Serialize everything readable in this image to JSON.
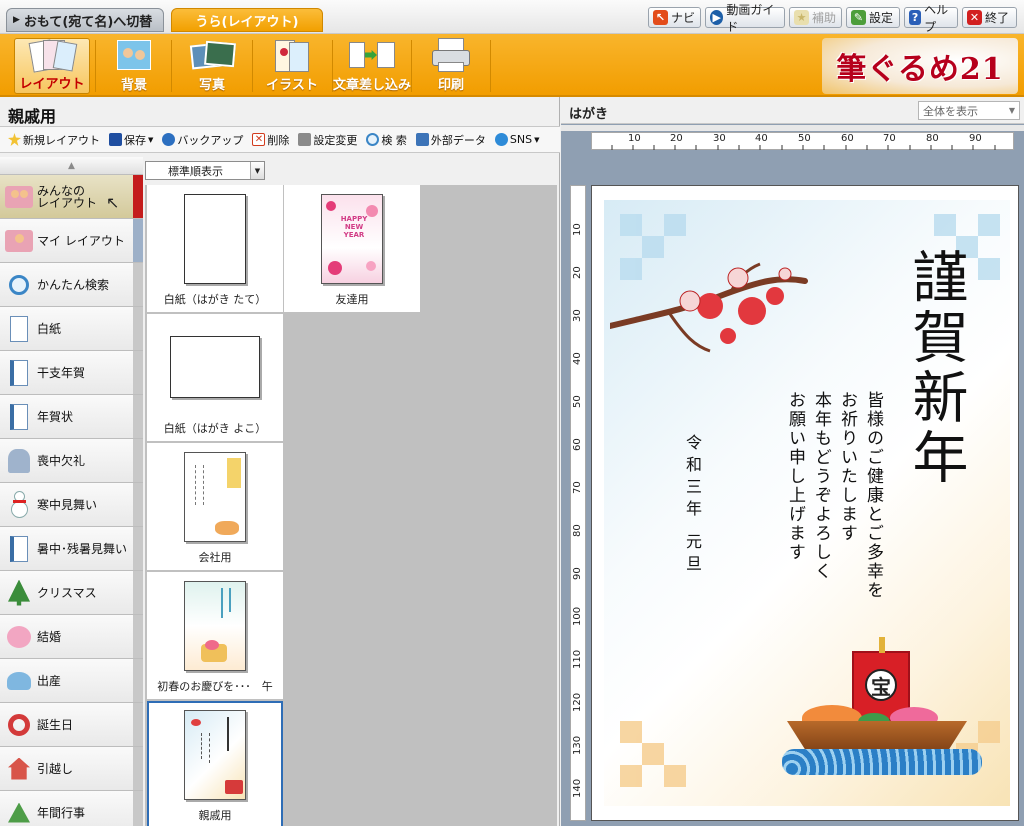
{
  "top_tabs": {
    "front": "おもて(宛て名)へ切替",
    "back": "うら(レイアウト)"
  },
  "utility_buttons": [
    {
      "label": "ナビ",
      "icon": "navi-arrow-icon"
    },
    {
      "label": "動画ガイド",
      "icon": "video-play-icon"
    },
    {
      "label": "補助",
      "icon": "assist-star-icon",
      "disabled": true
    },
    {
      "label": "設定",
      "icon": "settings-wrench-icon"
    },
    {
      "label": "ヘルプ",
      "icon": "help-question-icon"
    },
    {
      "label": "終了",
      "icon": "close-x-icon"
    }
  ],
  "toolbar": {
    "items": [
      {
        "label": "レイアウト",
        "icon": "layout-cards-icon",
        "active": true
      },
      {
        "label": "背景",
        "icon": "background-people-icon"
      },
      {
        "label": "写真",
        "icon": "photo-icon"
      },
      {
        "label": "イラスト",
        "icon": "illustration-icon"
      },
      {
        "label": "文章差し込み",
        "icon": "text-insert-icon"
      },
      {
        "label": "印刷",
        "icon": "printer-icon"
      }
    ],
    "logo": "筆ぐるめ21"
  },
  "left_panel": {
    "title": "親戚用",
    "actions": [
      {
        "label": "新規レイアウト",
        "icon": "new-layout-icon",
        "color": "#e0a000"
      },
      {
        "label": "保存",
        "icon": "save-floppy-icon",
        "color": "#1f4ea0",
        "dropdown": true
      },
      {
        "label": "バックアップ",
        "icon": "backup-icon",
        "color": "#2c6fc0"
      },
      {
        "label": "削除",
        "icon": "delete-icon",
        "color": "#d23c1e"
      },
      {
        "label": "設定変更",
        "icon": "settings-change-icon",
        "color": "#555555"
      },
      {
        "label": "検 索",
        "icon": "search-icon",
        "color": "#3b86c6"
      },
      {
        "label": "外部データ",
        "icon": "external-data-icon",
        "color": "#3d74b8"
      },
      {
        "label": "SNS",
        "icon": "sns-icon",
        "color": "#2e8bd8",
        "dropdown": true
      }
    ],
    "categories": [
      {
        "label": "みんなの\nレイアウト",
        "icon": "people-folder-icon",
        "selected": true
      },
      {
        "label": "マイ レイアウト",
        "icon": "person-folder-icon"
      },
      {
        "label": "かんたん検索",
        "icon": "magnifier-icon"
      },
      {
        "label": "白紙",
        "icon": "blank-page-icon"
      },
      {
        "label": "干支年賀",
        "icon": "zodiac-card-icon"
      },
      {
        "label": "年賀状",
        "icon": "new-year-card-icon"
      },
      {
        "label": "喪中欠礼",
        "icon": "mourning-card-icon"
      },
      {
        "label": "寒中見舞い",
        "icon": "snowman-icon"
      },
      {
        "label": "暑中･残暑見舞い",
        "icon": "summer-card-icon"
      },
      {
        "label": "クリスマス",
        "icon": "christmas-tree-icon"
      },
      {
        "label": "結婚",
        "icon": "wedding-hearts-icon"
      },
      {
        "label": "出産",
        "icon": "baby-stroller-icon"
      },
      {
        "label": "誕生日",
        "icon": "birthday-wreath-icon"
      },
      {
        "label": "引越し",
        "icon": "house-move-icon"
      },
      {
        "label": "年間行事",
        "icon": "annual-event-icon"
      }
    ],
    "sort": "標準順表示",
    "layouts": [
      {
        "label": "白紙（はがき たて）",
        "kind": "blank-portrait"
      },
      {
        "label": "友達用",
        "kind": "friends",
        "thumb_text": "HAPPY NEW YEAR"
      },
      {
        "label": "白紙（はがき よこ）",
        "kind": "blank-landscape"
      },
      {
        "label": "会社用",
        "kind": "company"
      },
      {
        "label": "初春のお慶びを･･･　午",
        "kind": "spring"
      },
      {
        "label": "親戚用",
        "kind": "relatives",
        "selected": true
      }
    ]
  },
  "right_panel": {
    "title": "はがき",
    "view_option": "全体を表示",
    "ruler_h": [
      "10",
      "20",
      "30",
      "40",
      "50",
      "60",
      "70",
      "80",
      "90"
    ],
    "ruler_v": [
      "10",
      "20",
      "30",
      "40",
      "50",
      "60",
      "70",
      "80",
      "90",
      "100",
      "110",
      "120",
      "130",
      "140"
    ],
    "card": {
      "heading": "謹賀新年",
      "body_lines": [
        "皆様のご健康とご多幸を",
        "お祈りいたします",
        "本年もどうぞよろしく",
        "お願い申し上げます"
      ],
      "date": "令和三年 元旦",
      "flag_char": "宝"
    }
  },
  "colors": {
    "accent_orange": "#f29d00",
    "selected_red": "#c41c1c",
    "selection_blue": "#2e6db6"
  }
}
